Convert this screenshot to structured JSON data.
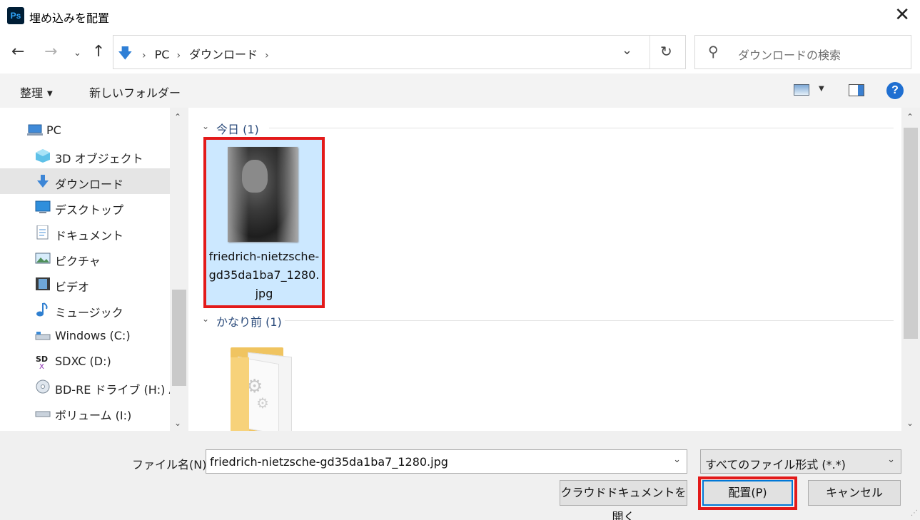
{
  "window": {
    "app_icon": "Ps",
    "title": "埋め込みを配置",
    "close_glyph": "✕"
  },
  "address_bar": {
    "crumbs": [
      "PC",
      "ダウンロード"
    ],
    "search_placeholder": "ダウンロードの検索"
  },
  "toolbar": {
    "organize_label": "整理",
    "new_folder_label": "新しいフォルダー",
    "help_glyph": "?"
  },
  "nav": {
    "items": [
      {
        "label": "PC",
        "icon": "pc-icon"
      },
      {
        "label": "3D オブジェクト",
        "icon": "3d-objects-icon"
      },
      {
        "label": "ダウンロード",
        "icon": "download-icon",
        "selected": true
      },
      {
        "label": "デスクトップ",
        "icon": "desktop-icon"
      },
      {
        "label": "ドキュメント",
        "icon": "documents-icon"
      },
      {
        "label": "ピクチャ",
        "icon": "pictures-icon"
      },
      {
        "label": "ビデオ",
        "icon": "videos-icon"
      },
      {
        "label": "ミュージック",
        "icon": "music-icon"
      },
      {
        "label": "Windows (C:)",
        "icon": "drive-icon"
      },
      {
        "label": "SDXC (D:)",
        "icon": "sd-card-icon"
      },
      {
        "label": "BD-RE ドライブ (H:) Au",
        "icon": "optical-drive-icon"
      },
      {
        "label": "ボリューム (I:)",
        "icon": "drive-icon"
      }
    ]
  },
  "content": {
    "groups": [
      {
        "label": "今日",
        "count": "(1)"
      },
      {
        "label": "かなり前",
        "count": "(1)"
      }
    ],
    "selected_file": "friedrich-nietzsche-gd35da1ba7_1280.jpg"
  },
  "footer": {
    "filename_label": "ファイル名(N):",
    "filename_value": "friedrich-nietzsche-gd35da1ba7_1280.jpg",
    "filter_value": "すべてのファイル形式 (*.*)",
    "cloud_button": "クラウドドキュメントを開く",
    "place_button": "配置(P)",
    "cancel_button": "キャンセル"
  },
  "colors": {
    "selection_fill": "#cce8ff",
    "highlight_frame": "#e31a1a",
    "accent": "#0078d7",
    "group_title": "#2a4a7a"
  }
}
